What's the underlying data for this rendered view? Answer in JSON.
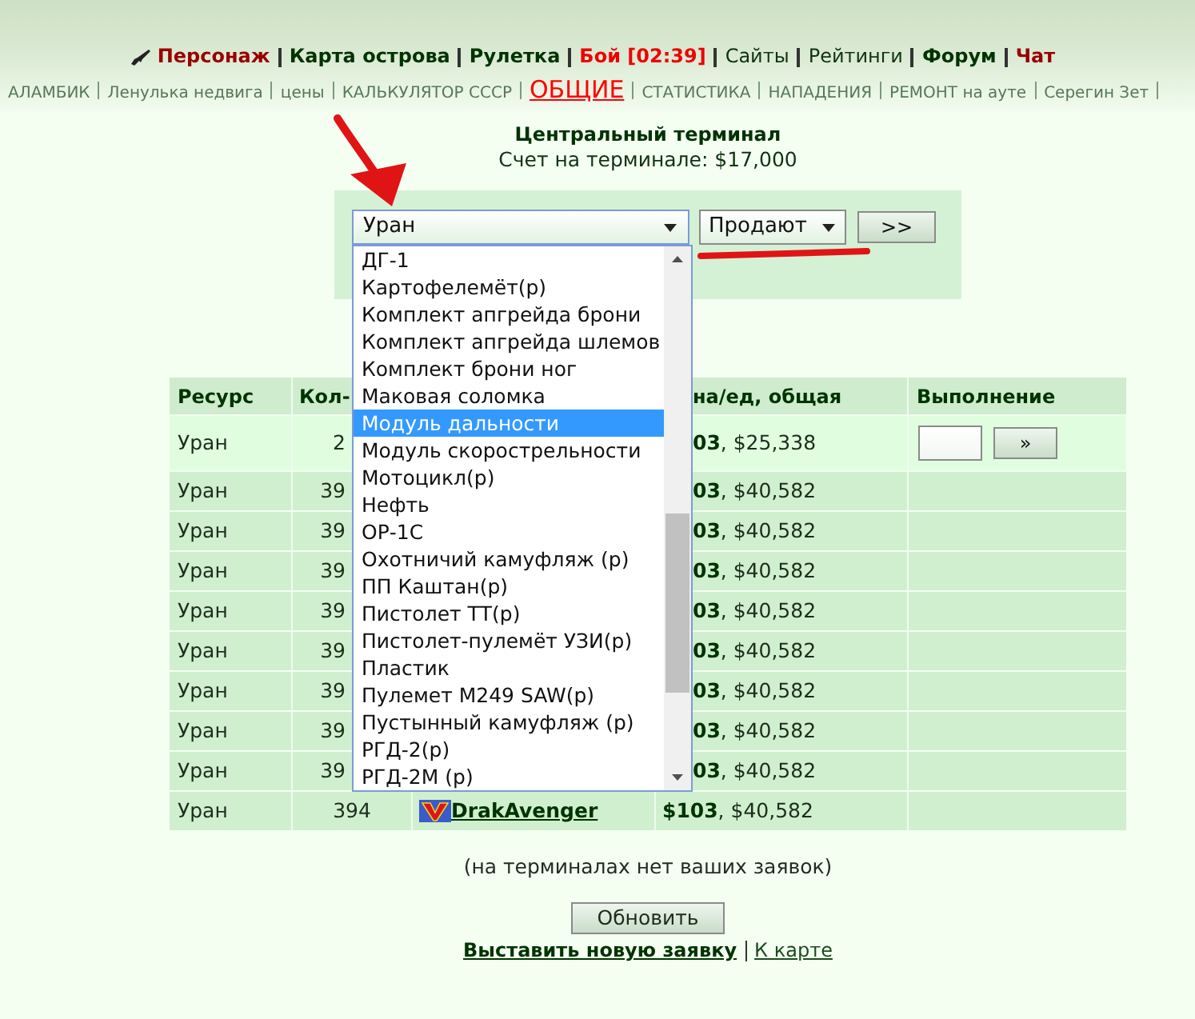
{
  "nav_main": [
    {
      "label": "Персонаж",
      "color": "#990000",
      "bold": true
    },
    {
      "label": "Карта острова",
      "color": "#003300",
      "bold": true
    },
    {
      "label": "Рулетка",
      "color": "#003300",
      "bold": true
    },
    {
      "label": "Бой [02:39]",
      "color": "#ee0000",
      "bold": true
    },
    {
      "label": "Сайты",
      "color": "#113311",
      "bold": false
    },
    {
      "label": "Рейтинги",
      "color": "#113311",
      "bold": false
    },
    {
      "label": "Форум",
      "color": "#003300",
      "bold": true
    },
    {
      "label": "Чат",
      "color": "#990000",
      "bold": true
    }
  ],
  "nav_sub": [
    {
      "label": "АЛАМБИК",
      "selected": false
    },
    {
      "label": "Ленулька недвига",
      "selected": false
    },
    {
      "label": "цены",
      "selected": false
    },
    {
      "label": "КАЛЬКУЛЯТОР СССР",
      "selected": false
    },
    {
      "label": "ОБЩИЕ",
      "selected": true
    },
    {
      "label": "СТАТИСТИКА",
      "selected": false
    },
    {
      "label": "НАПАДЕНИЯ",
      "selected": false
    },
    {
      "label": "РЕМОНТ на ауте",
      "selected": false
    },
    {
      "label": "Серегин Зет",
      "selected": false
    }
  ],
  "terminal": {
    "title": "Центральный терминал",
    "balance": "Счет на терминале: $17,000"
  },
  "filter": {
    "resource_select": {
      "value": "Уран",
      "expanded": true,
      "options": [
        {
          "label": "ДГ-1",
          "selected": false
        },
        {
          "label": "Картофелемёт(р)",
          "selected": false
        },
        {
          "label": "Комплект апгрейда брони",
          "selected": false
        },
        {
          "label": "Комплект апгрейда шлемов",
          "selected": false
        },
        {
          "label": "Комплект брони ног",
          "selected": false
        },
        {
          "label": "Маковая соломка",
          "selected": false
        },
        {
          "label": "Модуль дальности",
          "selected": true
        },
        {
          "label": "Модуль скорострельности",
          "selected": false
        },
        {
          "label": "Мотоцикл(р)",
          "selected": false
        },
        {
          "label": "Нефть",
          "selected": false
        },
        {
          "label": "ОР-1С",
          "selected": false
        },
        {
          "label": "Охотничий камуфляж (р)",
          "selected": false
        },
        {
          "label": "ПП Каштан(р)",
          "selected": false
        },
        {
          "label": "Пистолет ТТ(р)",
          "selected": false
        },
        {
          "label": "Пистолет-пулемёт УЗИ(р)",
          "selected": false
        },
        {
          "label": "Пластик",
          "selected": false
        },
        {
          "label": "Пулемет M249 SAW(р)",
          "selected": false
        },
        {
          "label": "Пустынный камуфляж (р)",
          "selected": false
        },
        {
          "label": "РГД-2(р)",
          "selected": false
        },
        {
          "label": "РГД-2М (р)",
          "selected": false
        }
      ]
    },
    "mode_select": {
      "value": "Продают"
    },
    "submit_button": ">>"
  },
  "table": {
    "header": {
      "resource": "Ресурс",
      "quantity": "Кол-",
      "price": "на/ед, общая",
      "execution": "Выполнение"
    },
    "rows": [
      {
        "resource": "Уран",
        "quantity": "2",
        "price": "**03**, $25,338",
        "highlighted": true,
        "execute_button": "»"
      },
      {
        "resource": "Уран",
        "quantity": "39",
        "price": "**03**, $40,582",
        "highlighted": false
      },
      {
        "resource": "Уран",
        "quantity": "39",
        "price": "**03**, $40,582",
        "highlighted": false
      },
      {
        "resource": "Уран",
        "quantity": "39",
        "price": "**03**, $40,582",
        "highlighted": false
      },
      {
        "resource": "Уран",
        "quantity": "39",
        "price": "**03**, $40,582",
        "highlighted": false
      },
      {
        "resource": "Уран",
        "quantity": "39",
        "price": "**03**, $40,582",
        "highlighted": false
      },
      {
        "resource": "Уран",
        "quantity": "39",
        "price": "**03**, $40,582",
        "highlighted": false
      },
      {
        "resource": "Уран",
        "quantity": "39",
        "price": "**03**, $40,582",
        "highlighted": false
      },
      {
        "resource": "Уран",
        "quantity": "39",
        "price": "**03**, $40,582",
        "highlighted": false
      },
      {
        "resource": "Уран",
        "quantity": "394",
        "seller": "DrakAvenger",
        "price": "**$103**, $40,582",
        "highlighted": false
      }
    ]
  },
  "footer": {
    "note": "(на терминалах нет ваших заявок)",
    "refresh_button": "Обновить",
    "links": [
      {
        "label": "Выставить новую заявку",
        "bold": true
      },
      {
        "label": "К карте",
        "bold": false
      }
    ]
  }
}
